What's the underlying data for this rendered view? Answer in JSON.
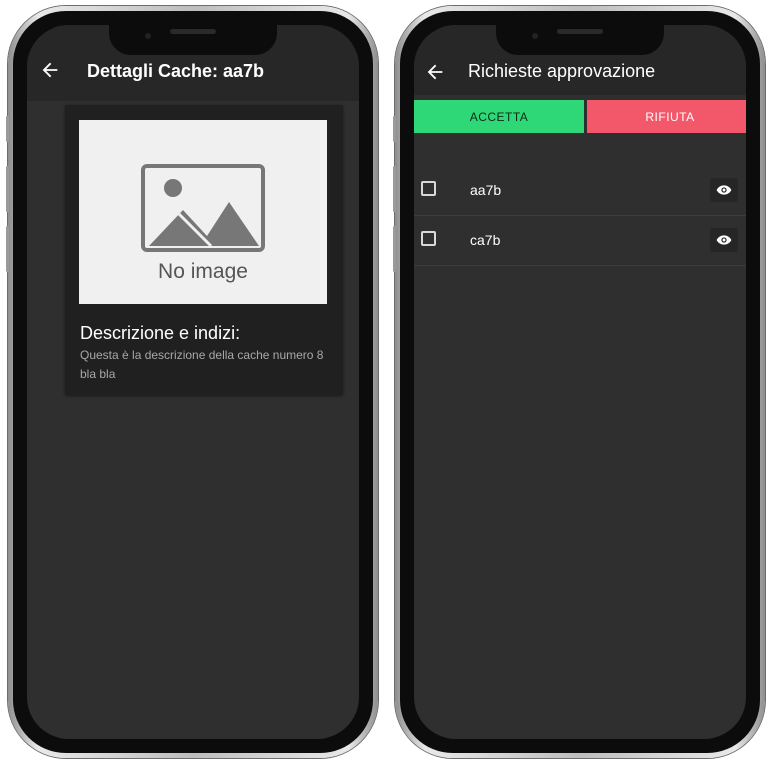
{
  "cache_detail": {
    "title": "Dettagli Cache: aa7b",
    "image_placeholder": "No image",
    "description_heading": "Descrizione e indizi:",
    "description_text": "Questa è la descrizione della cache numero 8 bla bla"
  },
  "approval": {
    "title": "Richieste approvazione",
    "accept_label": "ACCETTA",
    "reject_label": "RIFIUTA",
    "requests": [
      {
        "name": "aa7b",
        "checked": false
      },
      {
        "name": "ca7b",
        "checked": false
      }
    ]
  },
  "colors": {
    "accept": "#2fd876",
    "reject": "#f2586a",
    "background": "#2f2f2f",
    "appbar": "#272727"
  },
  "icons": [
    "back-arrow-icon",
    "eye-icon",
    "image-placeholder-icon",
    "checkbox-icon"
  ]
}
